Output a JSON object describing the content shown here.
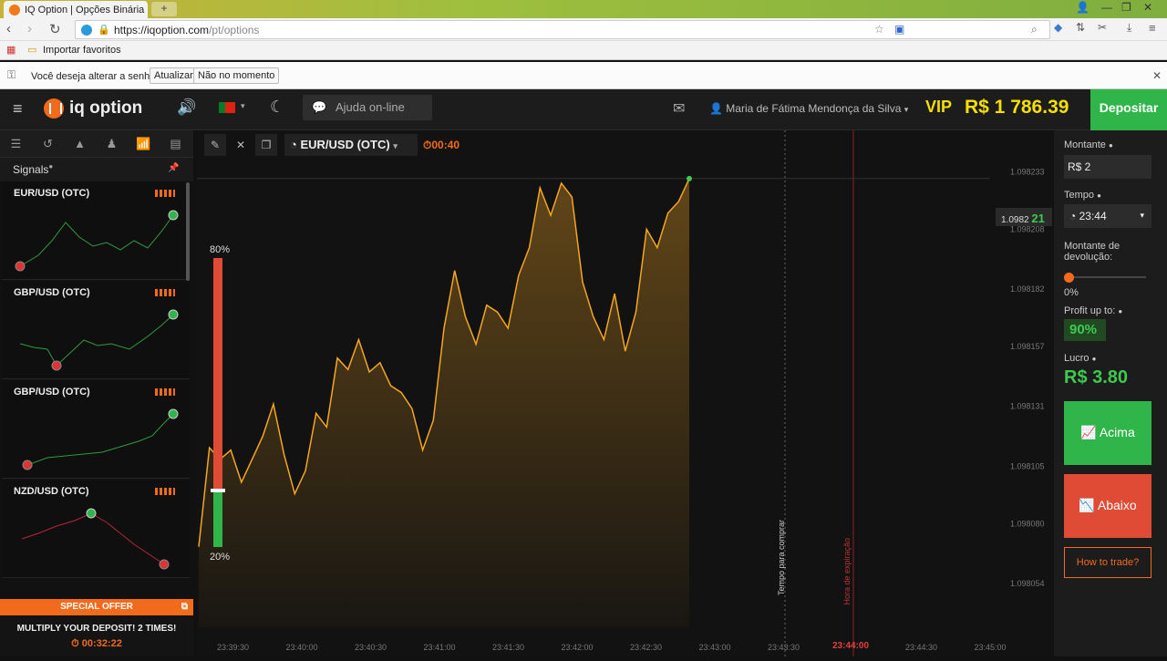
{
  "browser": {
    "tab_title": "IQ Option | Opções Binária",
    "url_host": "https://iqoption.com",
    "url_path": "/pt/options",
    "bookmark": "Importar favoritos",
    "infobar": {
      "question": "Você deseja alterar a senha?",
      "update": "Atualizar",
      "not_now": "Não no momento"
    }
  },
  "header": {
    "logo": "iq option",
    "help": "Ajuda on-line",
    "user": "Maria de Fátima Mendonça da Silva",
    "vip": "VIP",
    "balance": "R$ 1 786.39",
    "deposit": "Depositar"
  },
  "sidebar": {
    "title": "Signals",
    "signals": [
      {
        "name": "EUR/USD (OTC)"
      },
      {
        "name": "GBP/USD (OTC)"
      },
      {
        "name": "GBP/USD (OTC)"
      },
      {
        "name": "NZD/USD (OTC)"
      }
    ],
    "offer_title": "SPECIAL OFFER",
    "offer_text": "MULTIPLY YOUR DEPOSIT! 2 TIMES!",
    "offer_timer": "00:32:22"
  },
  "chart": {
    "asset": "EUR/USD (OTC)",
    "timer": "00:40",
    "current_price": "1.0982",
    "current_price_suffix": "21",
    "pct_high": "80%",
    "pct_low": "20%",
    "label_buy": "Tempo para comprar",
    "label_exp": "Hora de expiração",
    "expiration": "23:44:00"
  },
  "chart_data": {
    "type": "area",
    "x_ticks": [
      "23:39:30",
      "23:40:00",
      "23:40:30",
      "23:41:00",
      "23:41:30",
      "23:42:00",
      "23:42:30",
      "23:43:00",
      "23:43:30",
      "23:44:00",
      "23:44:30",
      "23:45:00"
    ],
    "y_ticks": [
      1.098233,
      1.098208,
      1.098182,
      1.098157,
      1.098131,
      1.098105,
      1.09808,
      1.098054
    ],
    "ylim": [
      1.098035,
      1.098245
    ],
    "series": [
      {
        "values": [
          1.09807,
          1.098113,
          1.098108,
          1.098112,
          1.098098,
          1.098108,
          1.098118,
          1.098132,
          1.09811,
          1.098093,
          1.098103,
          1.098128,
          1.098122,
          1.098152,
          1.098147,
          1.09816,
          1.098146,
          1.09815,
          1.09814,
          1.098137,
          1.09813,
          1.098112,
          1.098125,
          1.098165,
          1.09819,
          1.09817,
          1.098158,
          1.098175,
          1.098172,
          1.098165,
          1.098188,
          1.0982,
          1.098226,
          1.098214,
          1.098228,
          1.098222,
          1.098185,
          1.09817,
          1.09816,
          1.09818,
          1.098155,
          1.098172,
          1.098208,
          1.0982,
          1.098215,
          1.09822,
          1.09823
        ]
      }
    ],
    "grid": false
  },
  "panel": {
    "amount_label": "Montante",
    "amount": "R$ 2",
    "time_label": "Tempo",
    "time": "23:44",
    "return_label": "Montante de devolução:",
    "return_pct": "0%",
    "profit_label": "Profit up to:",
    "profit_pct": "90%",
    "lucro_label": "Lucro",
    "lucro": "R$ 3.80",
    "up": "Acima",
    "down": "Abaixo",
    "howto": "How to trade?"
  },
  "colors": {
    "accent": "#f26b1d",
    "up": "#2fb54a",
    "down": "#e04b35",
    "line": "#f5a623"
  }
}
